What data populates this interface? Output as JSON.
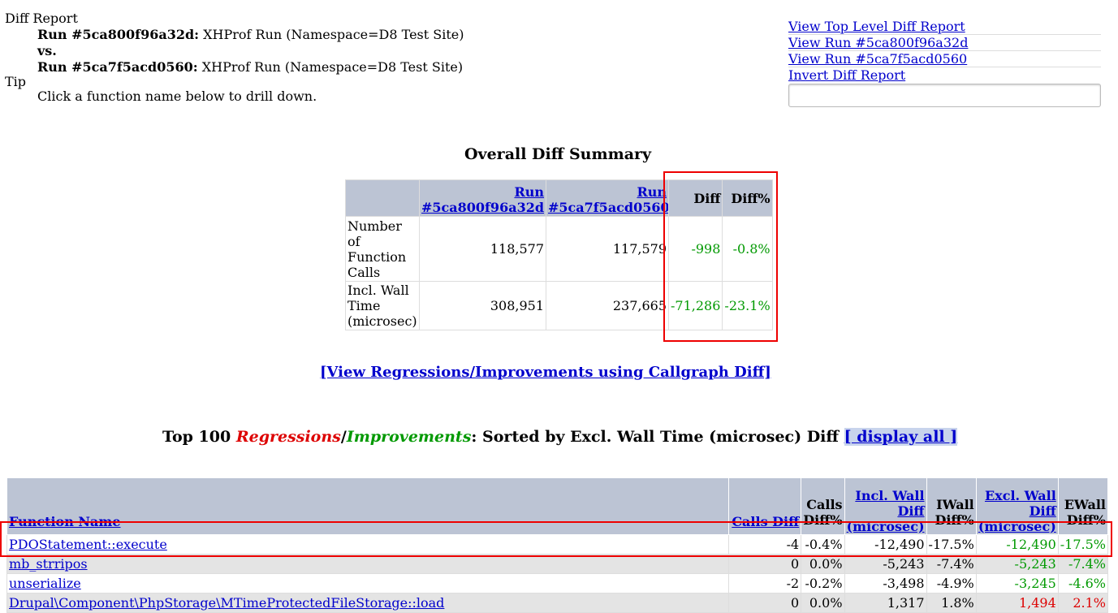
{
  "header": {
    "report_title": "Diff Report",
    "run1_label": "Run #5ca800f96a32d:",
    "run1_desc": "XHProf Run (Namespace=D8 Test Site)",
    "vs_label": "vs.",
    "run2_label": "Run #5ca7f5acd0560:",
    "run2_desc": "XHProf Run (Namespace=D8 Test Site)",
    "tip_label": "Tip",
    "tip_text": "Click a function name below to drill down."
  },
  "links": {
    "top_level": "View Top Level Diff Report",
    "run1": "View Run #5ca800f96a32d",
    "run2": "View Run #5ca7f5acd0560",
    "invert": "Invert Diff Report"
  },
  "summary": {
    "title": "Overall Diff Summary",
    "col_run1_a": "Run",
    "col_run1_b": "#5ca800f96a32d",
    "col_run2_a": "Run",
    "col_run2_b": "#5ca7f5acd0560",
    "col_diff": "Diff",
    "col_diffpct": "Diff%",
    "rows": [
      {
        "label_lines": [
          "Number",
          "of",
          "Function",
          "Calls"
        ],
        "run1": "118,577",
        "run2": "117,579",
        "diff": "-998",
        "diffpct": "-0.8%"
      },
      {
        "label_lines": [
          "Incl. Wall",
          "Time",
          "(microsec)"
        ],
        "run1": "308,951",
        "run2": "237,665",
        "diff": "-71,286",
        "diffpct": "-23.1%"
      }
    ]
  },
  "callgraph_link": "[View Regressions/Improvements using Callgraph Diff]",
  "top": {
    "prefix": "Top 100 ",
    "regressions": "Regressions",
    "slash": "/",
    "improvements": "Improvements",
    "suffix": ": Sorted by Excl. Wall Time (microsec) Diff ",
    "display_all": "[ display all ]"
  },
  "table": {
    "headers": {
      "fn": "Function Name",
      "calls_diff": "Calls Diff",
      "calls_pct_a": "Calls",
      "calls_pct_b": "Diff%",
      "iwall_a": "Incl. Wall",
      "iwall_b": "Diff",
      "iwall_c": "(microsec)",
      "iwall_pct_a": "IWall",
      "iwall_pct_b": "Diff%",
      "ewall_a": "Excl. Wall",
      "ewall_b": "Diff",
      "ewall_c": "(microsec)",
      "ewall_pct_a": "EWall",
      "ewall_pct_b": "Diff%"
    },
    "rows": [
      {
        "fn": "PDOStatement::execute",
        "calls": "-4",
        "calls_pct": "-0.4%",
        "iwall": "-12,490",
        "iwall_pct": "-17.5%",
        "ewall": "-12,490",
        "ewall_pct": "-17.5%",
        "ewall_color": "green"
      },
      {
        "fn": "mb_strripos",
        "calls": "0",
        "calls_pct": "0.0%",
        "iwall": "-5,243",
        "iwall_pct": "-7.4%",
        "ewall": "-5,243",
        "ewall_pct": "-7.4%",
        "ewall_color": "green"
      },
      {
        "fn": "unserialize",
        "calls": "-2",
        "calls_pct": "-0.2%",
        "iwall": "-3,498",
        "iwall_pct": "-4.9%",
        "ewall": "-3,245",
        "ewall_pct": "-4.6%",
        "ewall_color": "green"
      },
      {
        "fn": "Drupal\\Component\\PhpStorage\\MTimeProtectedFileStorage::load",
        "calls": "0",
        "calls_pct": "0.0%",
        "iwall": "1,317",
        "iwall_pct": "1.8%",
        "ewall": "1,494",
        "ewall_pct": "2.1%",
        "ewall_color": "red"
      }
    ]
  }
}
